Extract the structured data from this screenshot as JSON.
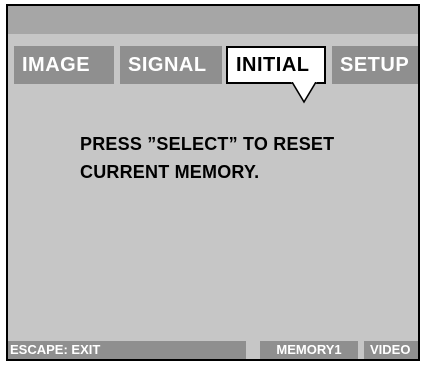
{
  "tabs": {
    "image": "IMAGE",
    "signal": "SIGNAL",
    "initial": "INITIAL",
    "setup": "SETUP"
  },
  "message": {
    "line1": "PRESS ”SELECT” TO RESET",
    "line2": "CURRENT MEMORY."
  },
  "status": {
    "escape": "ESCAPE: EXIT",
    "memory": "MEMORY1",
    "source": "VIDEO"
  },
  "colors": {
    "panel": "#c6c6c6",
    "tab_inactive": "#8f8f8f",
    "topbar": "#a6a6a6"
  }
}
